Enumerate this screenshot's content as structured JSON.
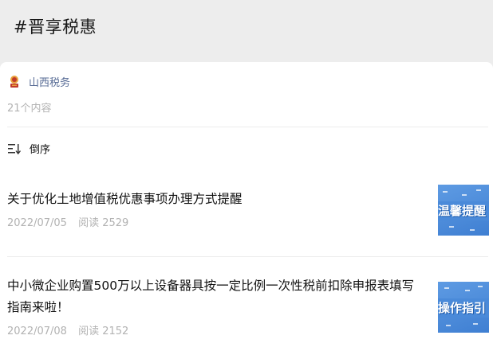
{
  "header": {
    "title": "#晋享税惠"
  },
  "account": {
    "name": "山西税务",
    "logo_icon": "tax-bureau-emblem-icon"
  },
  "collection": {
    "count_text": "21个内容"
  },
  "sort": {
    "label": "倒序",
    "icon": "sort-icon"
  },
  "articles": [
    {
      "title": "关于优化土地增值税优惠事项办理方式提醒",
      "date": "2022/07/05",
      "reads": "阅读 2529",
      "thumb_text": "温馨提醒"
    },
    {
      "title": "中小微企业购置500万以上设备器具按一定比例一次性税前扣除申报表填写指南来啦！",
      "date": "2022/07/08",
      "reads": "阅读 2152",
      "thumb_text": "操作指引"
    }
  ],
  "colors": {
    "link": "#576b95",
    "muted": "#b2b2b2",
    "thumb_blue": "#4a8ad9"
  }
}
